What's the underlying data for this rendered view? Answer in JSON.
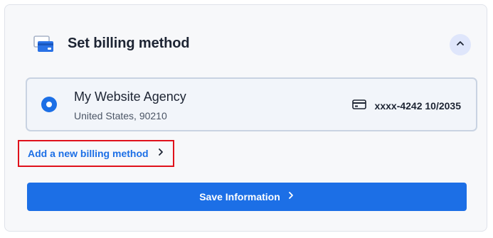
{
  "section": {
    "title": "Set billing method",
    "icon": "credit-cards-icon",
    "collapse_icon": "chevron-up-icon"
  },
  "billing_method": {
    "selected": true,
    "name": "My Website Agency",
    "address": "United States, 90210",
    "card_icon": "credit-card-icon",
    "card_number": "xxxx-4242",
    "card_expiry": "10/2035"
  },
  "add_method": {
    "label": "Add a new billing method",
    "icon": "chevron-right-icon"
  },
  "save_button": {
    "label": "Save Information",
    "icon": "chevron-right-icon"
  },
  "colors": {
    "accent": "#1c6fe6",
    "highlight_border": "#e0111b",
    "card_background": "#f7f8fa"
  }
}
